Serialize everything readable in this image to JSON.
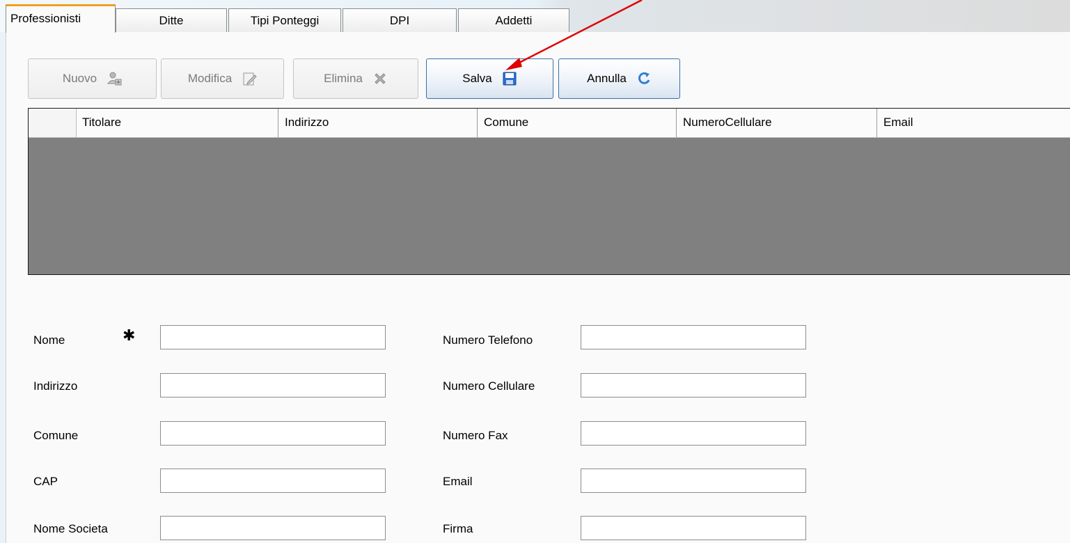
{
  "tabs": [
    {
      "label": "Professionisti",
      "active": true
    },
    {
      "label": "Ditte",
      "active": false
    },
    {
      "label": "Tipi Ponteggi",
      "active": false
    },
    {
      "label": "DPI",
      "active": false
    },
    {
      "label": "Addetti",
      "active": false
    }
  ],
  "toolbar": {
    "new_label": "Nuovo",
    "edit_label": "Modifica",
    "delete_label": "Elimina",
    "save_label": "Salva",
    "cancel_label": "Annulla"
  },
  "grid": {
    "columns": [
      "Titolare",
      "Indirizzo",
      "Comune",
      "NumeroCellulare",
      "Email"
    ],
    "rows": []
  },
  "form": {
    "required_marker": "✱",
    "left": [
      {
        "label": "Nome",
        "value": ""
      },
      {
        "label": "Indirizzo",
        "value": ""
      },
      {
        "label": "Comune",
        "value": ""
      },
      {
        "label": "CAP",
        "value": ""
      },
      {
        "label": "Nome Societa",
        "value": ""
      }
    ],
    "right": [
      {
        "label": "Numero Telefono",
        "value": ""
      },
      {
        "label": "Numero Cellulare",
        "value": ""
      },
      {
        "label": "Numero Fax",
        "value": ""
      },
      {
        "label": "Email",
        "value": ""
      },
      {
        "label": "Firma",
        "value": ""
      }
    ]
  },
  "colors": {
    "accent_tab": "#f0a020",
    "grid_background": "#808080",
    "annotation_arrow": "#e00000",
    "save_icon": "#1f5fbf"
  },
  "icons": {
    "new": "user-add-icon",
    "edit": "edit-document-icon",
    "delete": "delete-x-icon",
    "save": "floppy-disk-icon",
    "cancel": "refresh-undo-icon"
  }
}
